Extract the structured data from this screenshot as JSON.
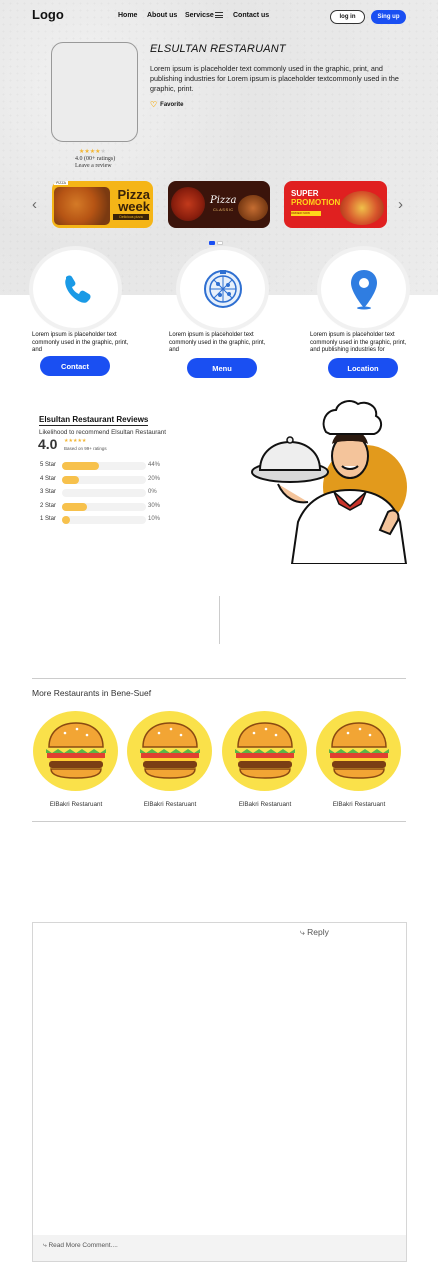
{
  "header": {
    "logo": "Logo",
    "nav": [
      "Home",
      "About us",
      "Servicse",
      "Contact us"
    ],
    "login": "log in",
    "signup": "Sing up"
  },
  "restaurant": {
    "name": "ELSULTAN RESTARUANT",
    "description": "Lorem ipsum is placeholder text commonly used in the graphic, print, and publishing industries for Lorem ipsum is placeholder textcommonly used in the graphic, print.",
    "rating_stars": 4,
    "rating_text": "4.0 (00+ ratings)",
    "leave_review": "Leave a review",
    "favorite": "Favorite"
  },
  "banners": [
    {
      "tag": "PIZZA",
      "line1": "Pizza",
      "line2": "week",
      "ribbon": "Delicious pizza"
    },
    {
      "title": "Pizza",
      "sub": "CLASSIC"
    },
    {
      "line1": "SUPER",
      "line2": "PROMOTION",
      "cta": "ORDER NOW"
    }
  ],
  "features": [
    {
      "text": "Lorem ipsum is placeholder text commonly used in the graphic, print, and",
      "button": "Contact",
      "icon": "phone-icon"
    },
    {
      "text": "Lorem ipsum is placeholder text commonly used in the graphic, print, and",
      "button": "Menu",
      "icon": "pizza-icon"
    },
    {
      "text": "Lorem ipsum is placeholder text commonly used in the graphic, print, and publishing industries for",
      "button": "Location",
      "icon": "location-pin-icon"
    }
  ],
  "reviews": {
    "title": "Elsultan Restaurant Reviews",
    "subtitle": "Likelihood to recommend Elsultan Restaurant",
    "score": "4.0",
    "based_on": "Based on 99+ ratings",
    "rows": [
      {
        "label": "5 Star",
        "percent": 44,
        "pct_text": "44%"
      },
      {
        "label": "4 Star",
        "percent": 20,
        "pct_text": "20%"
      },
      {
        "label": "3 Star",
        "percent": 0,
        "pct_text": "0%"
      },
      {
        "label": "2 Star",
        "percent": 30,
        "pct_text": "30%"
      },
      {
        "label": "1 Star",
        "percent": 10,
        "pct_text": "10%"
      }
    ]
  },
  "more_restaurants": {
    "title": "More Restaurants in Bene-Suef",
    "items": [
      "ElBakri Restaruant",
      "ElBakri Restaruant",
      "ElBakri Restaruant",
      "ElBakri Restaruant"
    ]
  },
  "comments": {
    "reply": "Reply",
    "read_more": "Read More Comment...."
  },
  "colors": {
    "accent": "#1a4ff2",
    "star": "#f3b633",
    "bar": "#f7c14c",
    "card": "#fae14a"
  }
}
